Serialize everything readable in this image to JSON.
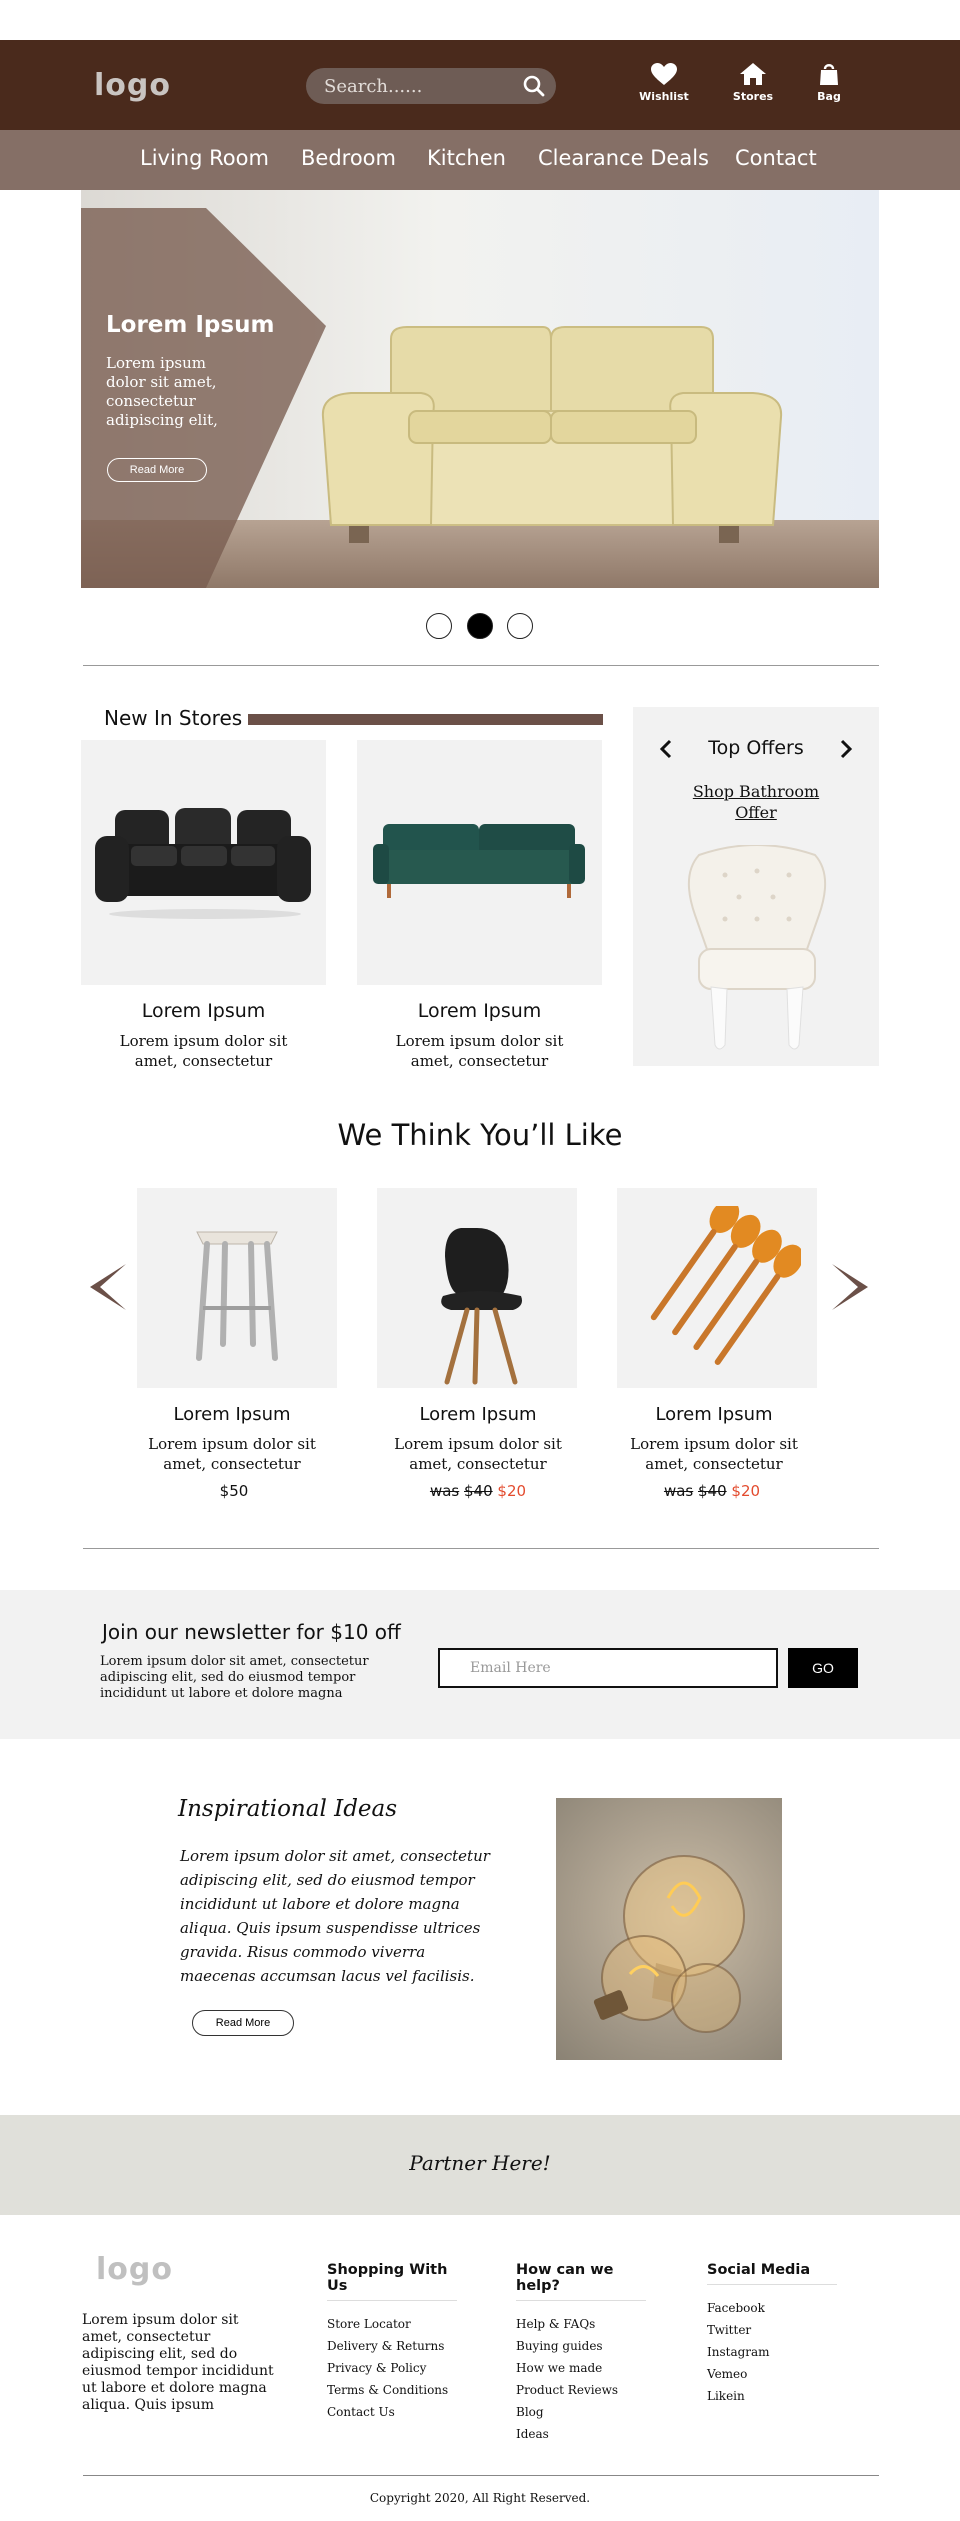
{
  "header": {
    "logo": "logo",
    "search_placeholder": "Search......",
    "icons": [
      {
        "label": "Wishlist",
        "icon": "heart-icon"
      },
      {
        "label": "Stores",
        "icon": "home-icon"
      },
      {
        "label": "Bag",
        "icon": "bag-icon"
      }
    ]
  },
  "nav": [
    "Living Room",
    "Bedroom",
    "Kitchen",
    "Clearance Deals",
    "Contact"
  ],
  "hero": {
    "title": "Lorem Ipsum",
    "text": "Lorem ipsum dolor sit amet, consectetur adipiscing elit,",
    "button": "Read More",
    "slides": 3,
    "active_slide": 2
  },
  "new_in_stores": {
    "title": "New In Stores",
    "products": [
      {
        "name": "Lorem Ipsum",
        "desc": "Lorem ipsum dolor sit amet, consectetur"
      },
      {
        "name": "Lorem Ipsum",
        "desc": "Lorem ipsum dolor sit amet, consectetur"
      }
    ]
  },
  "top_offers": {
    "title": "Top Offers",
    "link": "Shop Bathroom Offer"
  },
  "recommendations": {
    "title": "We Think You’ll Like",
    "products": [
      {
        "name": "Lorem Ipsum",
        "desc": "Lorem ipsum dolor sit amet, consectetur",
        "price": "$50",
        "was_label": "",
        "was_price": "",
        "sale_price": ""
      },
      {
        "name": "Lorem Ipsum",
        "desc": "Lorem ipsum dolor sit amet, consectetur",
        "price": "",
        "was_label": "was",
        "was_price": "$40",
        "sale_price": "$20"
      },
      {
        "name": "Lorem Ipsum",
        "desc": "Lorem ipsum dolor sit amet, consectetur",
        "price": "",
        "was_label": "was",
        "was_price": "$40",
        "sale_price": "$20"
      }
    ]
  },
  "newsletter": {
    "title": "Join our newsletter for $10 off",
    "text": "Lorem ipsum dolor sit amet, consectetur adipiscing elit, sed do eiusmod tempor incididunt ut labore et dolore magna",
    "placeholder": "Email Here",
    "button": "GO"
  },
  "inspiration": {
    "title": "Inspirational Ideas",
    "text": "Lorem ipsum dolor sit amet, consectetur adipiscing elit, sed do eiusmod tempor incididunt ut labore et dolore magna aliqua. Quis ipsum suspendisse ultrices gravida. Risus commodo viverra maecenas accumsan lacus vel facilisis.",
    "button": "Read More"
  },
  "partner": "Partner Here!",
  "footer": {
    "logo": "logo",
    "text": "Lorem ipsum dolor sit amet, consectetur adipiscing elit, sed do eiusmod tempor incididunt ut labore et dolore magna aliqua. Quis ipsum",
    "columns": [
      {
        "title": "Shopping With Us",
        "links": [
          "Store Locator",
          "Delivery & Returns",
          "Privacy & Policy",
          "Terms & Conditions",
          "Contact Us"
        ]
      },
      {
        "title": "How can we help?",
        "links": [
          "Help & FAQs",
          "Buying guides",
          "How we made",
          "Product Reviews",
          "Blog",
          "Ideas"
        ]
      },
      {
        "title": "Social Media",
        "links": [
          "Facebook",
          "Twitter",
          "Instagram",
          "Vemeo",
          "Likein"
        ]
      }
    ],
    "copyright": "Copyright 2020, All Right Reserved."
  },
  "colors": {
    "header_bg": "#4a2a1c",
    "nav_bg": "#856f66",
    "accent_bar": "#6b5048",
    "sale": "#e34b2e",
    "partner_bg": "#e0e0da"
  }
}
